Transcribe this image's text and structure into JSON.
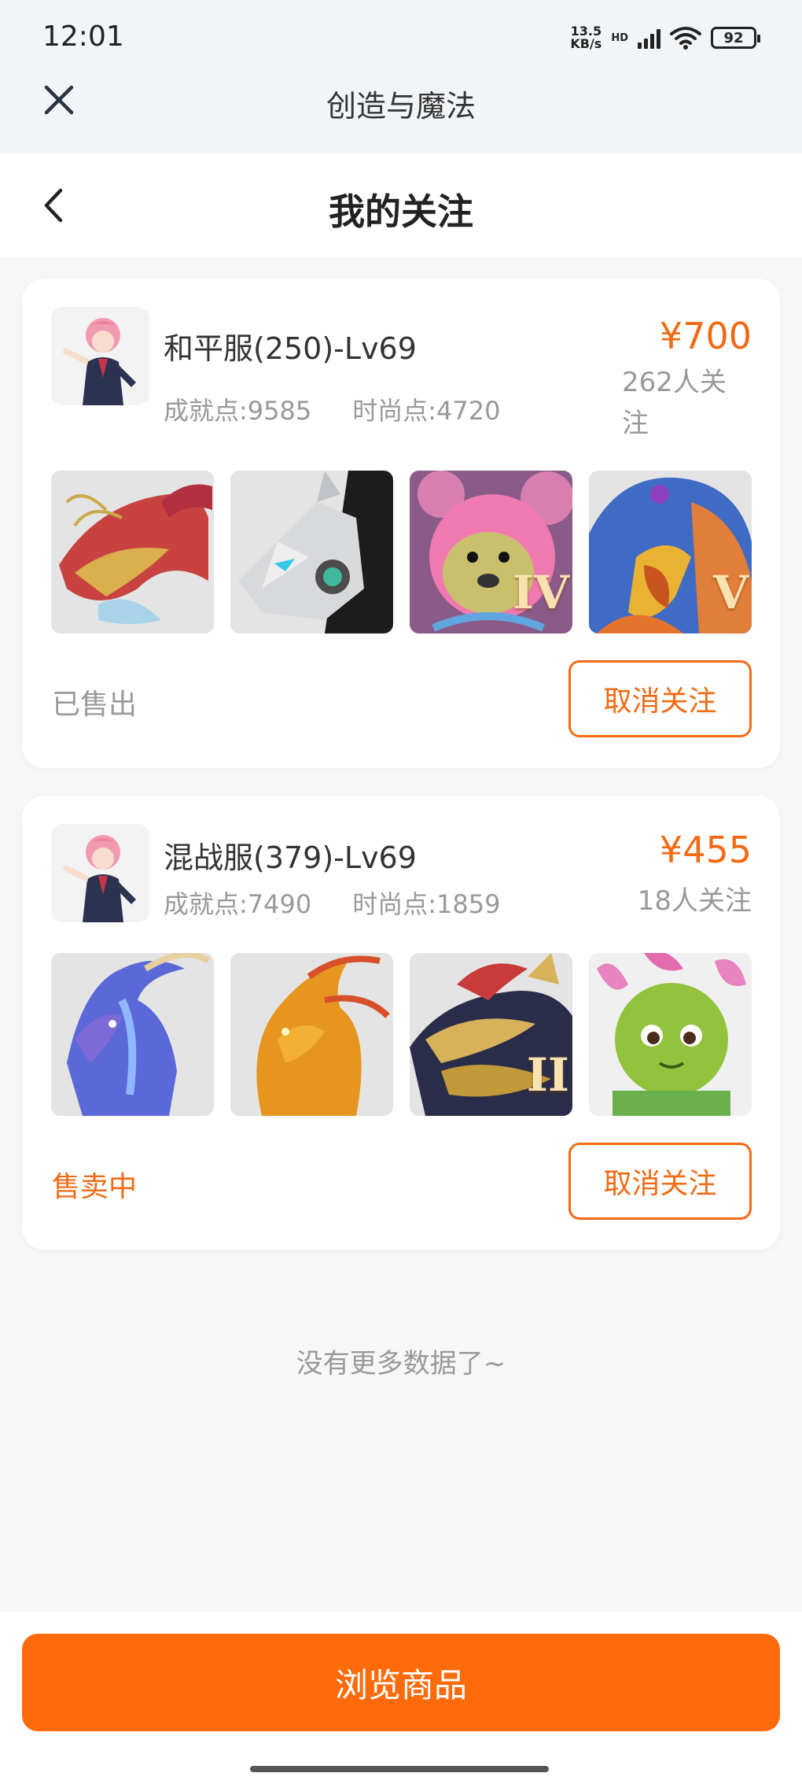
{
  "status_bar": {
    "time": "12:01",
    "net_speed_value": "13.5",
    "net_speed_unit": "KB/s",
    "hd": "HD",
    "battery": "92"
  },
  "mini_app": {
    "title": "创造与魔法"
  },
  "header": {
    "title": "我的关注"
  },
  "colors": {
    "accent": "#ff6a0a",
    "price": "#f26a13",
    "muted": "#999999"
  },
  "cards": [
    {
      "server": "和平服(250)-Lv69",
      "achievement": "成就点:9585",
      "fashion": "时尚点:4720",
      "price": "¥700",
      "followers": "262人关注",
      "thumbs": [
        {
          "icon": "red-dragon-mount-icon",
          "tier": ""
        },
        {
          "icon": "mech-wolf-mount-icon",
          "tier": ""
        },
        {
          "icon": "pink-bear-pet-icon",
          "tier": "IV"
        },
        {
          "icon": "phoenix-bird-mount-icon",
          "tier": "V"
        }
      ],
      "status": "已售出",
      "unfollow_label": "取消关注"
    },
    {
      "server": "混战服(379)-Lv69",
      "achievement": "成就点:7490",
      "fashion": "时尚点:1859",
      "price": "¥455",
      "followers": "18人关注",
      "thumbs": [
        {
          "icon": "blue-phoenix-mount-icon",
          "tier": ""
        },
        {
          "icon": "fire-phoenix-mount-icon",
          "tier": ""
        },
        {
          "icon": "golden-dragon-mount-icon",
          "tier": "II"
        },
        {
          "icon": "cactus-flower-pet-icon",
          "tier": ""
        }
      ],
      "status": "售卖中",
      "unfollow_label": "取消关注"
    }
  ],
  "footer": {
    "no_more": "没有更多数据了~",
    "browse_label": "浏览商品"
  }
}
